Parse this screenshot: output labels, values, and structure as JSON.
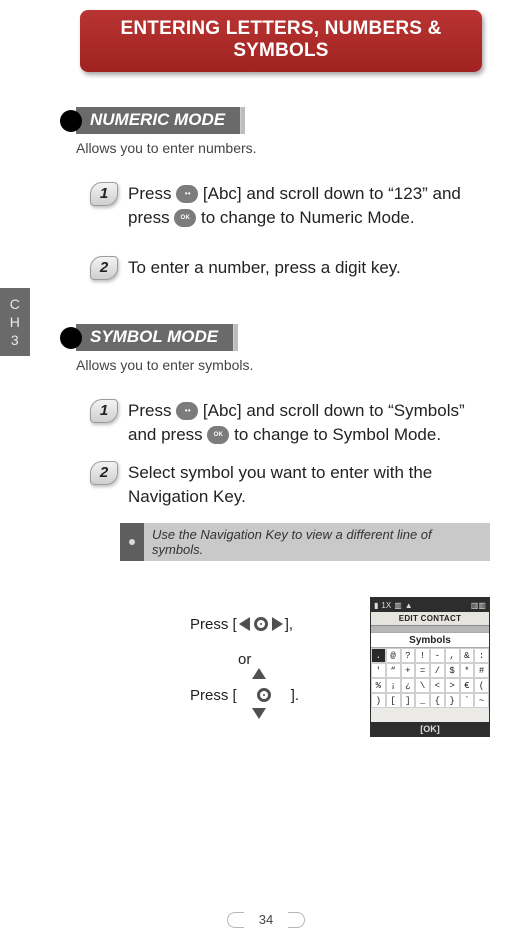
{
  "header": {
    "title": "ENTERING LETTERS, NUMBERS & SYMBOLS"
  },
  "side_tab": {
    "line1": "C",
    "line2": "H",
    "line3": "3"
  },
  "icons": {
    "soft_key": "soft-key-icon",
    "ok_key": "OK"
  },
  "sections": [
    {
      "title": "NUMERIC MODE",
      "subtitle": "Allows you to enter numbers.",
      "steps": [
        {
          "n": "1",
          "pre": "Press ",
          "mid": " [Abc] and scroll down to “123” and press ",
          "post": " to change to Numeric Mode."
        },
        {
          "n": "2",
          "text": "To enter a number, press a digit key."
        }
      ]
    },
    {
      "title": "SYMBOL MODE",
      "subtitle": "Allows you to enter symbols.",
      "steps": [
        {
          "n": "1",
          "pre": "Press ",
          "mid": " [Abc] and scroll down to “Symbols” and press ",
          "post": " to change to Symbol Mode."
        },
        {
          "n": "2",
          "text": "Select symbol you want to enter with the Navigation Key."
        }
      ],
      "tip": "Use the Navigation Key to view a different line of symbols."
    }
  ],
  "nav": {
    "press1_pre": "Press [ ",
    "press1_post": " ],",
    "or": "or",
    "press2_pre": "Press [",
    "press2_post": "]."
  },
  "phone": {
    "status_left": "1X",
    "bar": "EDIT CONTACT",
    "title": "Symbols",
    "rows": [
      [
        ".",
        "@",
        "?",
        "!",
        "-",
        ",",
        "&",
        ":"
      ],
      [
        "'",
        "“",
        "+",
        "=",
        "/",
        "$",
        "*",
        "#"
      ],
      [
        "%",
        "¡",
        "¿",
        "\\",
        "<",
        ">",
        "€",
        "("
      ],
      [
        ")",
        "[",
        "]",
        "_",
        "{",
        "}",
        "`",
        "~"
      ]
    ],
    "softkey": "OK"
  },
  "page_number": "34"
}
